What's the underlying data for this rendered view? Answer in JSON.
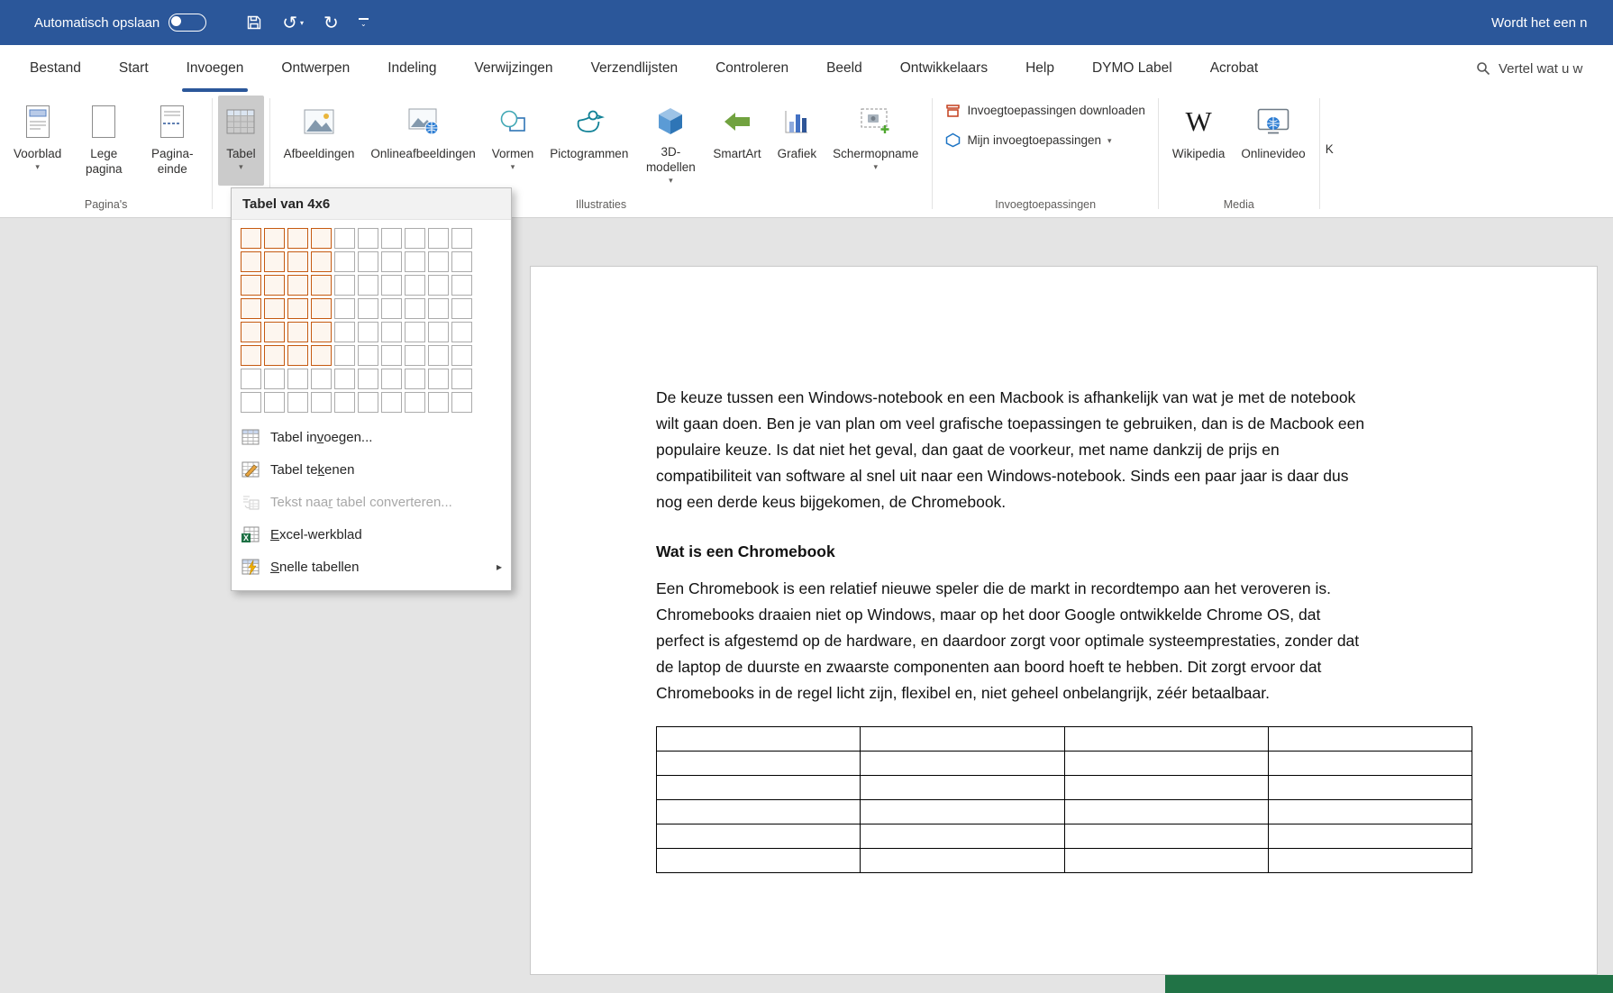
{
  "titlebar": {
    "autosave_label": "Automatisch opslaan",
    "document_title": "Wordt het een n"
  },
  "icons": {
    "undo_glyph": "↺",
    "redo_glyph": "↻",
    "caret_glyph": "▾",
    "submenu_glyph": "▸",
    "customize_chevron": "⌄",
    "wikipedia_glyph": "W"
  },
  "tabs": [
    {
      "label": "Bestand",
      "active": false
    },
    {
      "label": "Start",
      "active": false
    },
    {
      "label": "Invoegen",
      "active": true
    },
    {
      "label": "Ontwerpen",
      "active": false
    },
    {
      "label": "Indeling",
      "active": false
    },
    {
      "label": "Verwijzingen",
      "active": false
    },
    {
      "label": "Verzendlijsten",
      "active": false
    },
    {
      "label": "Controleren",
      "active": false
    },
    {
      "label": "Beeld",
      "active": false
    },
    {
      "label": "Ontwikkelaars",
      "active": false
    },
    {
      "label": "Help",
      "active": false
    },
    {
      "label": "DYMO Label",
      "active": false
    },
    {
      "label": "Acrobat",
      "active": false
    }
  ],
  "search_label": "Vertel wat u w",
  "ribbon": {
    "groups": {
      "pages": {
        "label": "Pagina's",
        "buttons": [
          {
            "label": "Voorblad",
            "caret": true
          },
          {
            "label": "Lege pagina",
            "caret": false
          },
          {
            "label": "Pagina-einde",
            "caret": false
          }
        ]
      },
      "tables": {
        "button": {
          "label": "Tabel",
          "caret": true,
          "pressed": true
        }
      },
      "illustrations": {
        "label": "Illustraties",
        "buttons": [
          {
            "label": "Afbeeldingen",
            "caret": false
          },
          {
            "label": "Onlineafbeeldingen",
            "caret": false
          },
          {
            "label": "Vormen",
            "caret": true
          },
          {
            "label": "Pictogrammen",
            "caret": false
          },
          {
            "label": "3D-modellen",
            "caret": true
          },
          {
            "label": "SmartArt",
            "caret": false
          },
          {
            "label": "Grafiek",
            "caret": false
          },
          {
            "label": "Schermopname",
            "caret": true
          }
        ]
      },
      "addins": {
        "label": "Invoegtoepassingen",
        "items": [
          {
            "label": "Invoegtoepassingen downloaden",
            "caret": false
          },
          {
            "label": "Mijn invoegtoepassingen",
            "caret": true
          }
        ]
      },
      "media": {
        "label": "Media",
        "buttons": [
          {
            "label": "Wikipedia",
            "caret": false
          },
          {
            "label": "Onlinevideo",
            "caret": false
          }
        ]
      },
      "partial_label": "K"
    }
  },
  "table_dropdown": {
    "header": "Tabel van 4x6",
    "grid": {
      "cols": 10,
      "rows": 8,
      "selected_cols": 4,
      "selected_rows": 6
    },
    "items": [
      {
        "label": "Tabel invoegen...",
        "accel_index": 8,
        "disabled": false,
        "submenu": false
      },
      {
        "label": "Tabel tekenen",
        "accel_index": 8,
        "disabled": false,
        "submenu": false
      },
      {
        "label": "Tekst naar tabel converteren...",
        "accel_index": 9,
        "disabled": true,
        "submenu": false
      },
      {
        "label": "Excel-werkblad",
        "accel_index": 0,
        "disabled": false,
        "submenu": false
      },
      {
        "label": "Snelle tabellen",
        "accel_index": 0,
        "disabled": false,
        "submenu": true
      }
    ]
  },
  "document": {
    "paragraph1_lines": [
      "De keuze tussen een Windows-notebook en een Macbook is afhankelijk van wat je met de notebook",
      "wilt gaan doen. Ben je van plan om veel grafische toepassingen te gebruiken, dan is de Macbook een",
      "populaire keuze. Is dat niet het geval, dan gaat de voorkeur, met name dankzij de prijs en",
      "compatibiliteit van software al snel uit naar een Windows-notebook. Sinds een paar jaar is daar dus",
      "nog een derde keus bijgekomen, de Chromebook."
    ],
    "heading": "Wat is een Chromebook",
    "paragraph2_lines": [
      "Een Chromebook is een relatief nieuwe speler die de markt in recordtempo aan het veroveren is.",
      "Chromebooks draaien niet op Windows, maar op het door Google ontwikkelde Chrome OS, dat",
      "perfect is afgestemd op de hardware, en daardoor zorgt voor optimale systeemprestaties, zonder dat",
      "de laptop de duurste en zwaarste componenten aan boord hoeft te hebben. Dit zorgt ervoor dat",
      "Chromebooks in de regel licht zijn, flexibel en, niet geheel onbelangrijk, zéér betaalbaar."
    ],
    "table": {
      "rows": 6,
      "cols": 4
    }
  },
  "colors": {
    "titlebar": "#2b579a",
    "accent": "#2b579a",
    "grid_selected_border": "#c55a11",
    "green_bar": "#217346",
    "doc_background": "#e4e4e4"
  }
}
